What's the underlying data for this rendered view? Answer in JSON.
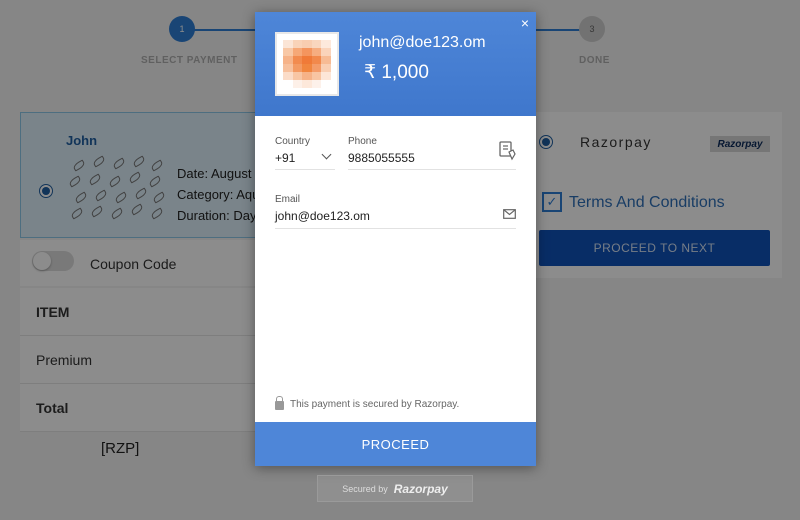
{
  "steps": [
    {
      "num": "1",
      "label": "SELECT PAYMENT"
    },
    {
      "num": "3",
      "label": "DONE"
    }
  ],
  "plan": {
    "name": "John",
    "date": "Date: August",
    "category": "Category: Aqu",
    "duration": "Duration: Day"
  },
  "coupon": {
    "label": "Coupon Code"
  },
  "table": {
    "rows": [
      "ITEM",
      "Premium",
      "Total"
    ]
  },
  "rzp_placeholder": "[RZP]",
  "payment": {
    "provider": "Razorpay",
    "logo_text": "Razorpay",
    "terms": "Terms And Conditions",
    "proceed_next": "PROCEED TO NEXT"
  },
  "modal": {
    "merchant_email": "john@doe123.om",
    "amount": "₹ 1,000",
    "close_icon": "×",
    "country_label": "Country",
    "country_value": "+91",
    "phone_label": "Phone",
    "phone_value": "9885055555",
    "email_label": "Email",
    "email_value": "john@doe123.om",
    "secure_note": "This payment is secured by Razorpay.",
    "proceed": "PROCEED"
  },
  "secured_by": {
    "prefix": "Secured by",
    "brand": "Razorpay"
  },
  "colors": {
    "accent": "#4e86d8",
    "primary_button": "#0f52ba",
    "link": "#2f6fb8"
  }
}
